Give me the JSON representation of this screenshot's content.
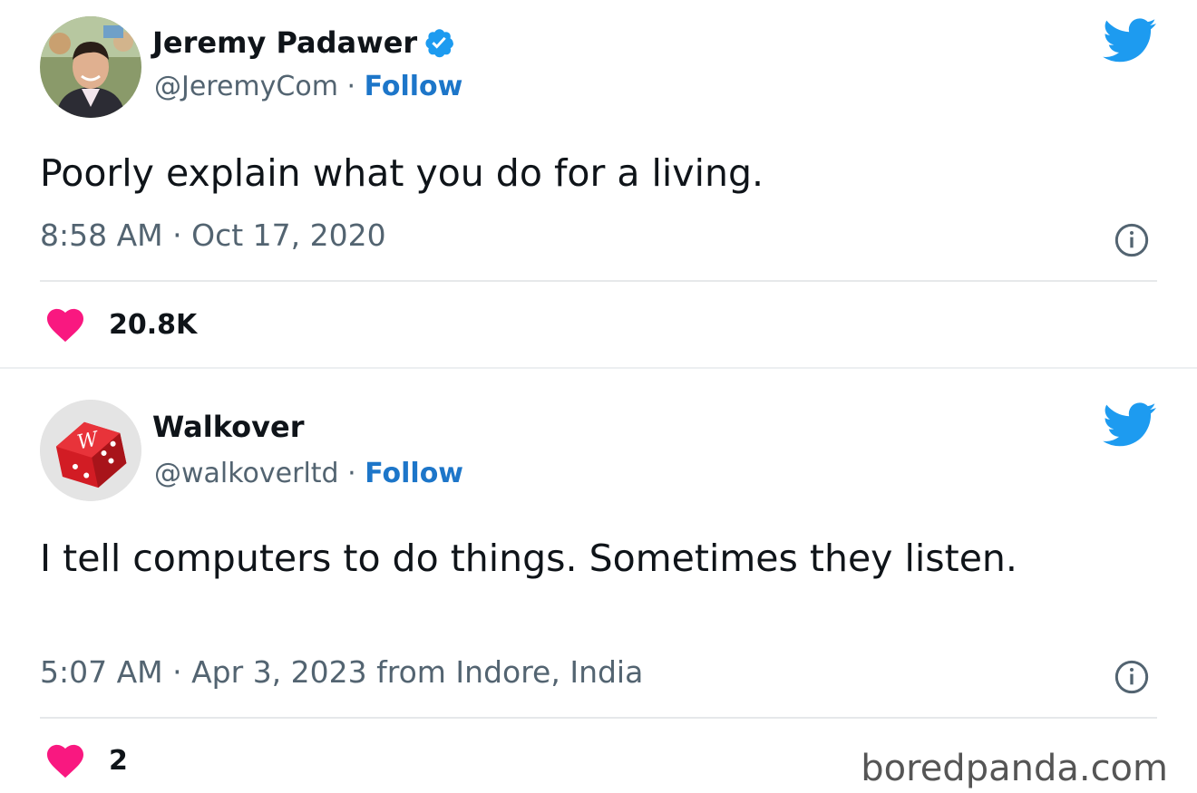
{
  "tweets": [
    {
      "author": {
        "name": "Jeremy Padawer",
        "verified": true,
        "handle": "@JeremyCom",
        "follow_label": "Follow",
        "separator": "·"
      },
      "text": "Poorly explain what you do for a living.",
      "meta": "8:58 AM · Oct 17, 2020",
      "likes": "20.8K"
    },
    {
      "author": {
        "name": "Walkover",
        "verified": false,
        "handle": "@walkoverltd",
        "follow_label": "Follow",
        "separator": "·"
      },
      "text": "I tell computers to do things. Sometimes they listen.",
      "meta": "5:07 AM · Apr 3, 2023 from Indore, India",
      "likes": "2",
      "watermark": "boredpanda.com"
    }
  ],
  "colors": {
    "twitter_blue": "#1d9bf0",
    "follow_blue": "#1d76c9",
    "heart_pink": "#f91880",
    "muted_text": "#536471"
  },
  "icons": {
    "bird": "twitter-bird-icon",
    "info": "info-icon",
    "heart": "heart-icon",
    "verified": "verified-badge-icon"
  }
}
